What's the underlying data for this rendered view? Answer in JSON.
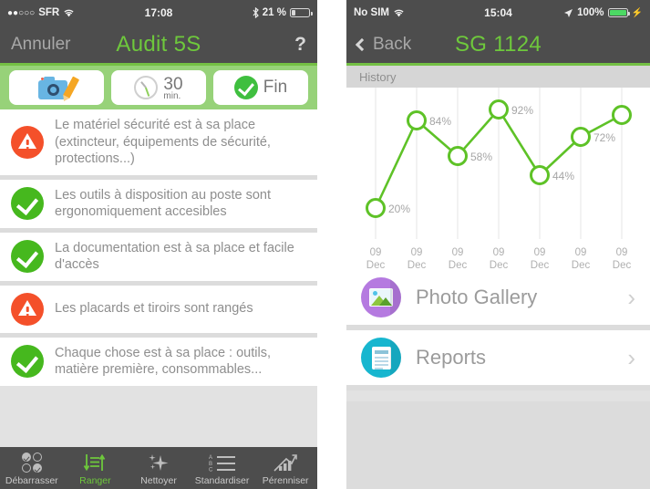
{
  "left_phone": {
    "status_bar": {
      "carrier": "SFR",
      "signal_dots": "●●○○○",
      "wifi_icon": "wifi-icon",
      "time": "17:08",
      "bluetooth_icon": "bluetooth-icon",
      "battery_percent": "21 %",
      "battery_icon": "battery-low-icon"
    },
    "nav_bar": {
      "cancel_label": "Annuler",
      "title": "Audit 5S",
      "help_label": "?"
    },
    "toolbar": {
      "photo_button": {
        "icon": "camera-edit-icon"
      },
      "timer_button": {
        "icon": "clock-icon",
        "value": "30",
        "unit": "min."
      },
      "finish_button": {
        "icon": "check-circle-icon",
        "label": "Fin"
      }
    },
    "checklist": [
      {
        "status": "warn",
        "text": "Le matériel sécurité est à sa place (extincteur, équipements de sécurité, protections...)"
      },
      {
        "status": "ok",
        "text": "Les outils à disposition au poste sont ergonomiquement accesibles"
      },
      {
        "status": "ok",
        "text": "La documentation est à sa place et facile d'accès"
      },
      {
        "status": "warn",
        "text": "Les placards et tiroirs sont rangés"
      },
      {
        "status": "ok",
        "text": "Chaque chose est à sa place : outils, matière première, consommables..."
      }
    ],
    "tab_bar": [
      {
        "label": "Débarrasser",
        "icon": "checkbox-grid-icon",
        "active": false
      },
      {
        "label": "Ranger",
        "icon": "sort-arrows-icon",
        "active": true
      },
      {
        "label": "Nettoyer",
        "icon": "sparkle-icon",
        "active": false
      },
      {
        "label": "Standardiser",
        "icon": "abc-list-icon",
        "active": false
      },
      {
        "label": "Pérenniser",
        "icon": "bar-chart-up-icon",
        "active": false
      }
    ]
  },
  "right_phone": {
    "status_bar": {
      "carrier": "No SIM",
      "wifi_icon": "wifi-icon",
      "time": "15:04",
      "location_icon": "location-arrow-icon",
      "battery_percent": "100%",
      "battery_icon": "battery-full-icon",
      "charging_icon": "charging-bolt-icon"
    },
    "nav_bar": {
      "back_label": "Back",
      "title": "SG 1124"
    },
    "section_header": "History",
    "rows": [
      {
        "label": "Photo Gallery",
        "icon": "photo-gallery-icon",
        "chevron": "›"
      },
      {
        "label": "Reports",
        "icon": "reports-icon",
        "chevron": "›"
      }
    ]
  },
  "chart_data": {
    "type": "line",
    "title": "History",
    "xlabel": "",
    "ylabel": "",
    "ylim": [
      0,
      100
    ],
    "grid": true,
    "legend": "none",
    "categories": [
      "09 Dec",
      "09 Dec",
      "09 Dec",
      "09 Dec",
      "09 Dec",
      "09 Dec",
      "09 Dec"
    ],
    "tick_labels_top": [
      "09",
      "09",
      "09",
      "09",
      "09",
      "09",
      "09"
    ],
    "tick_labels_bottom": [
      "Dec",
      "Dec",
      "Dec",
      "Dec",
      "Dec",
      "Dec",
      "Dec"
    ],
    "values": [
      20,
      84,
      58,
      92,
      44,
      72,
      88
    ],
    "point_labels": [
      "20%",
      "84%",
      "58%",
      "92%",
      "44%",
      "72%",
      ""
    ],
    "series_color": "#5ec227",
    "marker": "open-circle"
  },
  "colors": {
    "brand_green": "#6ec83c",
    "line_green": "#5ec227",
    "nav_dark": "#4d4d4d",
    "toolbar_green": "#97d279",
    "ok_green": "#46b81e",
    "warn_orange": "#f4502a",
    "gray_bg": "#dcdcdc",
    "text_gray": "#8e8e8e",
    "photo_purple": "#b57ae0",
    "reports_teal": "#17b6cf"
  }
}
